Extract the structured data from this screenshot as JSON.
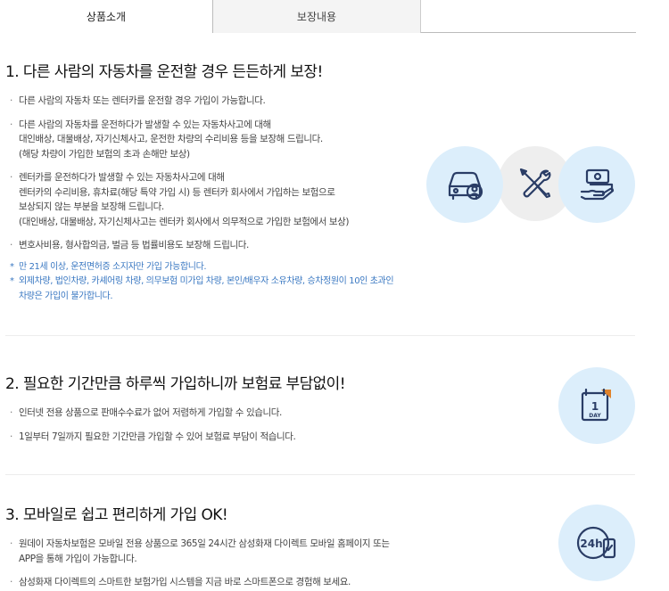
{
  "tabs": [
    {
      "label": "상품소개",
      "active": true
    },
    {
      "label": "보장내용",
      "active": false
    }
  ],
  "sections": [
    {
      "title": "1. 다른 사람의 자동차를 운전할 경우 든든하게 보장!",
      "bullets": [
        "다른 사람의 자동차 또는 렌터카를 운전할 경우 가입이 가능합니다.",
        "다른 사람의 자동차를 운전하다가 발생할 수 있는 자동차사고에 대해\n대인배상, 대물배상, 자기신체사고, 운전한 차량의 수리비용 등을 보장해 드립니다.\n(해당 차량이 가입한 보험의 초과 손해만 보상)",
        "렌터카를 운전하다가 발생할 수 있는 자동차사고에 대해\n렌터카의 수리비용, 휴차료(해당 특약 가입 시) 등 렌터카 회사에서 가입하는 보험으로\n보상되지 않는 부분을 보장해 드립니다.\n(대인배상, 대물배상, 자기신체사고는 렌터카 회사에서 의무적으로 가입한 보험에서 보상)",
        "변호사비용, 형사합의금, 벌금 등 법률비용도 보장해 드립니다."
      ],
      "notes": [
        "만 21세 이상, 운전면허증 소지자만 가입 가능합니다.",
        "외제차량, 법인차량, 카셰어링 차량, 의무보험 미가입 차량, 본인/배우자 소유차량, 승차정원이 10인 초과인\n차량은 가입이 불가합니다."
      ]
    },
    {
      "title": "2. 필요한 기간만큼 하루씩 가입하니까 보험료 부담없이!",
      "bullets": [
        "인터넷 전용 상품으로 판매수수료가 없어 저렴하게 가입할 수 있습니다.",
        "1일부터 7일까지 필요한 기간만큼 가입할 수 있어 보험료 부담이 적습니다."
      ]
    },
    {
      "title": "3. 모바일로 쉽고 편리하게 가입 OK!",
      "bullets": [
        "원데이 자동차보험은 모바일 전용 상품으로 365일 24시간 삼성화재 다이렉트 모바일 홈페이지 또는\nAPP을 통해 가입이 가능합니다.",
        "삼성화재 다이렉트의 스마트한 보험가입 시스템을 지금 바로 스마트폰으로 경험해 보세요."
      ]
    }
  ],
  "icons": {
    "car": "car-driver-icon",
    "tools": "wrench-screwdriver-icon",
    "money": "money-hand-icon",
    "calendar": "calendar-1-day-icon",
    "calendar_text_num": "1",
    "calendar_text_day": "DAY",
    "clock": "24h-phone-icon",
    "clock_text": "24h"
  },
  "colors": {
    "icon_blue_bg": "#dceefb",
    "icon_grey_bg": "#eeeeee",
    "icon_stroke": "#2a3d66",
    "note_blue": "#3a78c2"
  }
}
